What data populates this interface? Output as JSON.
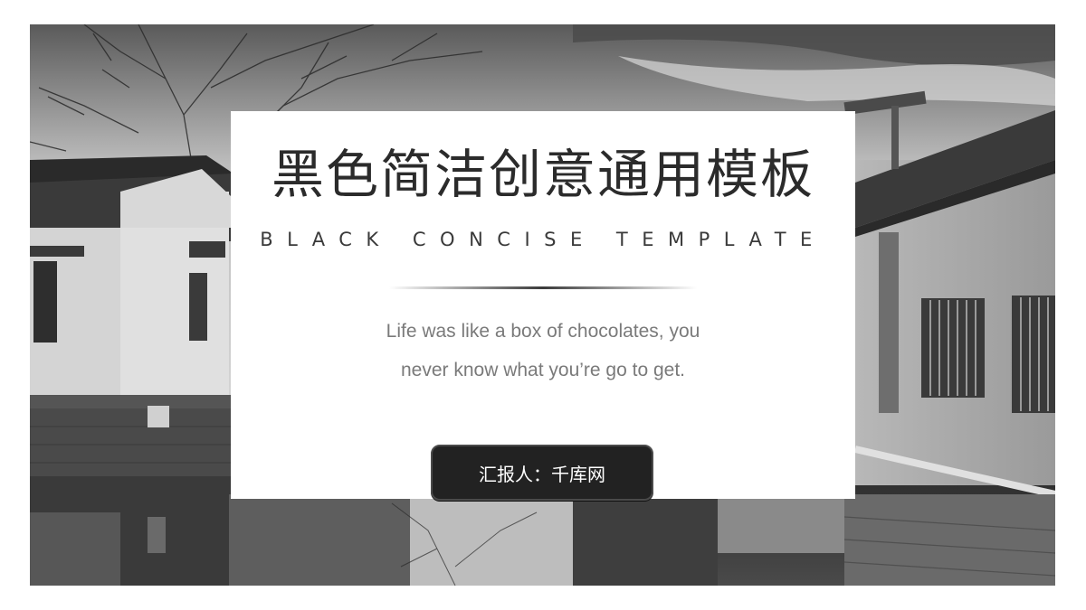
{
  "slide": {
    "title_cn": "黑色简洁创意通用模板",
    "title_en": "BLACK CONCISE TEMPLATE",
    "quote_line1": "Life was like a box of chocolates, you",
    "quote_line2": "never know what you’re go to get.",
    "reporter_label": "汇报人：千库网"
  },
  "colors": {
    "card_background": "#ffffff",
    "title_text": "#2b2b2b",
    "quote_text": "#7a7a7a",
    "button_background": "#222222",
    "button_text": "#ffffff"
  }
}
